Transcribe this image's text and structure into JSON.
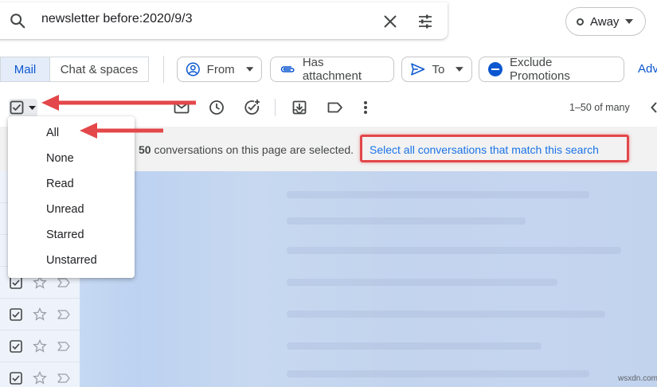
{
  "search": {
    "query": "newsletter before:2020/9/3"
  },
  "status": {
    "label": "Away"
  },
  "view_tabs": {
    "mail": "Mail",
    "chat": "Chat & spaces"
  },
  "filters": {
    "from": "From",
    "attachment": "Has attachment",
    "to": "To",
    "exclude": "Exclude Promotions",
    "advanced": "Adv"
  },
  "toolbar": {
    "pagination": "1–50 of many"
  },
  "selection": {
    "count": "50",
    "message": "conversations on this page are selected.",
    "select_all_link": "Select all conversations that match this search"
  },
  "select_menu": {
    "items": [
      "All",
      "None",
      "Read",
      "Unread",
      "Starred",
      "Unstarred"
    ]
  },
  "watermark": "wsxdn.com",
  "colors": {
    "accent": "#0b57d0",
    "annotation": "#e3474a",
    "link": "#1a73e8"
  }
}
